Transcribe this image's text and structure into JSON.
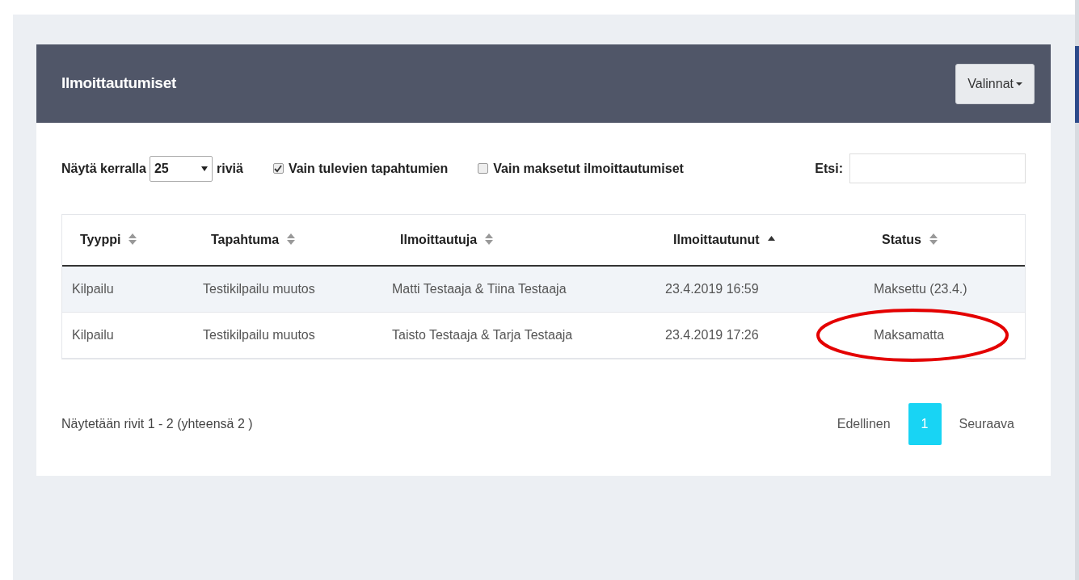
{
  "panel": {
    "title": "Ilmoittautumiset",
    "menu_button": "Valinnat"
  },
  "filters": {
    "show_prefix": "Näytä kerralla",
    "page_size": "25",
    "show_suffix": "riviä",
    "checkboxes": [
      {
        "label": "Vain tulevien tapahtumien",
        "checked": true
      },
      {
        "label": "Vain maksetut ilmoittautumiset",
        "checked": false
      }
    ],
    "search_label": "Etsi:"
  },
  "table": {
    "columns": [
      {
        "label": "Tyyppi",
        "sorted": false
      },
      {
        "label": "Tapahtuma",
        "sorted": false
      },
      {
        "label": "Ilmoittautuja",
        "sorted": false
      },
      {
        "label": "Ilmoittautunut",
        "sorted": true
      },
      {
        "label": "Status",
        "sorted": false
      }
    ],
    "rows": [
      {
        "cells": [
          "Kilpailu",
          "Testikilpailu muutos",
          "Matti Testaaja & Tiina Testaaja",
          "23.4.2019 16:59",
          "Maksettu (23.4.)"
        ],
        "circled": false
      },
      {
        "cells": [
          "Kilpailu",
          "Testikilpailu muutos",
          "Taisto Testaaja & Tarja Testaaja",
          "23.4.2019 17:26",
          "Maksamatta"
        ],
        "circled": true
      }
    ]
  },
  "footer": {
    "info": "Näytetään rivit 1 - 2 (yhteensä 2 )",
    "pages": [
      {
        "label": "Edellinen",
        "selected": false
      },
      {
        "label": "1",
        "selected": true
      },
      {
        "label": "Seuraava",
        "selected": false
      }
    ]
  }
}
